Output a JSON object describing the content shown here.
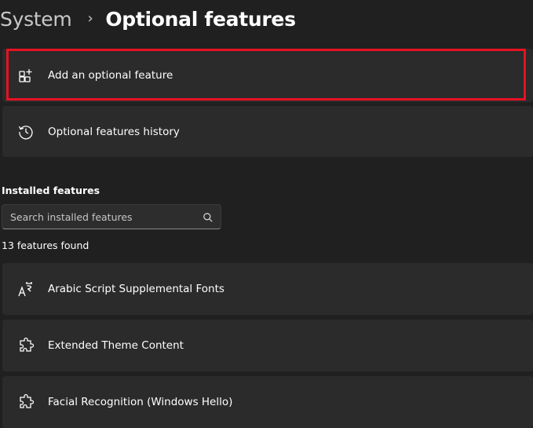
{
  "header": {
    "parent": "System",
    "separator": "›",
    "current": "Optional features"
  },
  "cards": {
    "add": {
      "label": "Add an optional feature",
      "icon": "add-apps-icon"
    },
    "history": {
      "label": "Optional features history",
      "icon": "history-icon"
    }
  },
  "installed": {
    "title": "Installed features",
    "search_placeholder": "Search installed features",
    "count_text": "13 features found",
    "items": [
      {
        "label": "Arabic Script Supplemental Fonts",
        "icon": "font-icon"
      },
      {
        "label": "Extended Theme Content",
        "icon": "puzzle-icon"
      },
      {
        "label": "Facial Recognition (Windows Hello)",
        "icon": "puzzle-icon"
      }
    ]
  },
  "colors": {
    "background": "#202020",
    "card": "#2b2b2b",
    "highlight": "#e81123"
  }
}
